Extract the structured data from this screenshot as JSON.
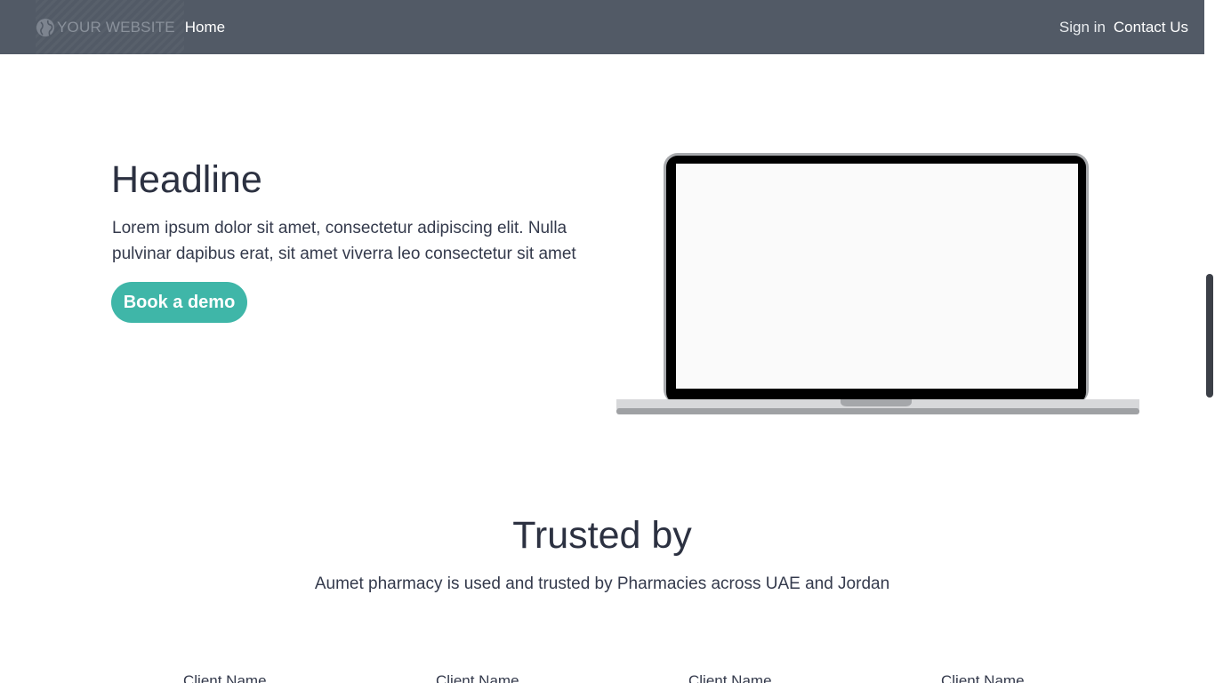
{
  "navbar": {
    "brand_label": "YOUR WEBSITE",
    "brand_icon": "globe-icon",
    "home_label": "Home",
    "signin_label": "Sign in",
    "contact_label": "Contact Us"
  },
  "hero": {
    "headline": "Headline",
    "text": "Lorem ipsum dolor sit amet, consectetur adipiscing elit. Nulla pulvinar dapibus erat, sit amet viverra leo consectetur sit amet",
    "cta_label": "Book a demo"
  },
  "trusted": {
    "title": "Trusted by",
    "subtitle": "Aumet pharmacy is used and trusted by Pharmacies across UAE and Jordan",
    "clients": [
      "Client Name",
      "Client Name",
      "Client Name",
      "Client Name"
    ]
  },
  "colors": {
    "navbar_bg": "#525a66",
    "accent": "#3fb6a8",
    "heading_text": "#2c3141"
  }
}
